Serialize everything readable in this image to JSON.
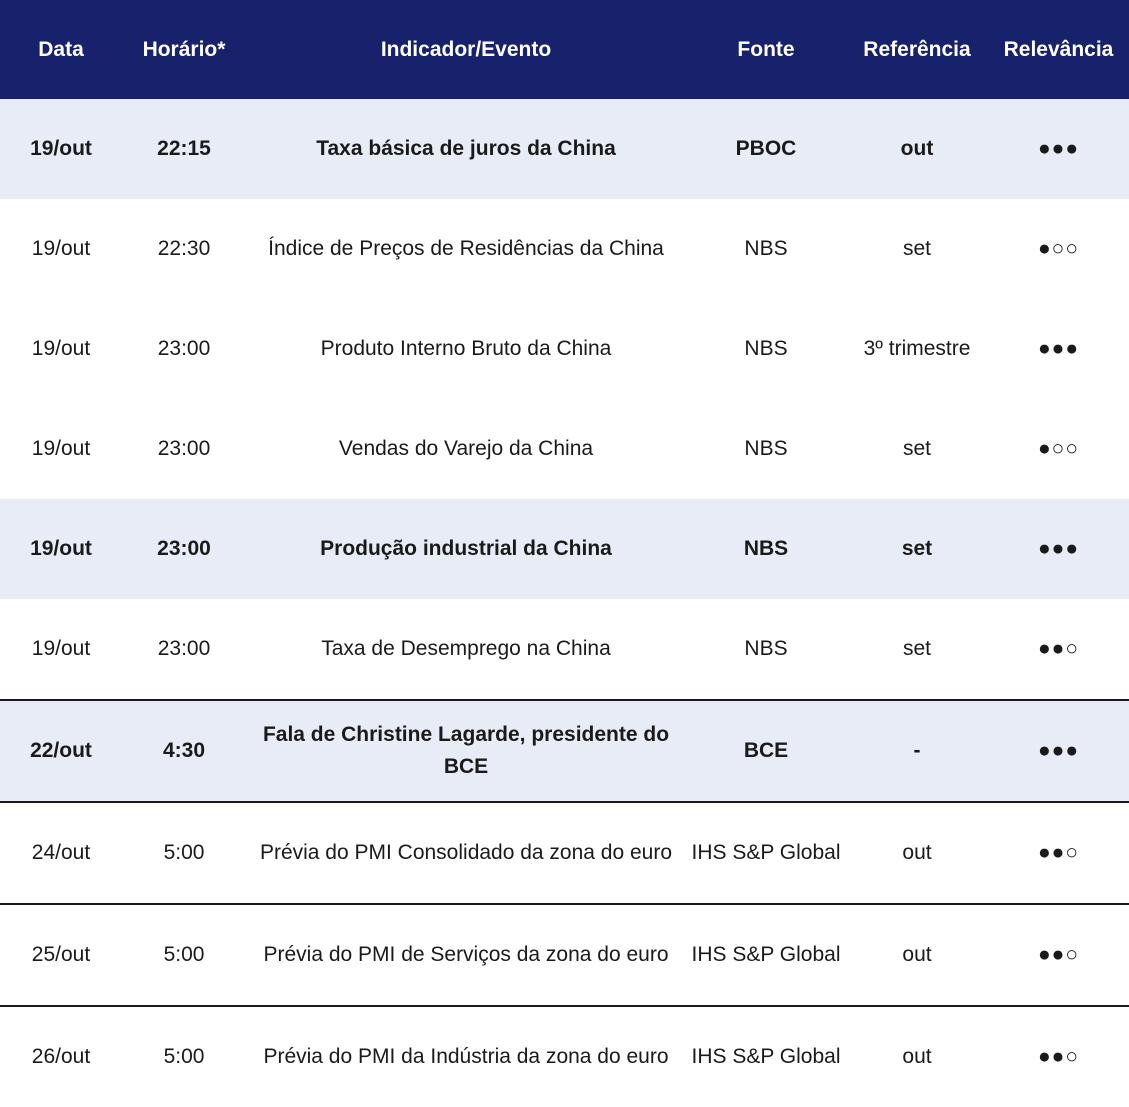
{
  "headers": {
    "date": "Data",
    "time": "Horário*",
    "event": "Indicador/Evento",
    "source": "Fonte",
    "reference": "Referência",
    "relevance": "Relevância"
  },
  "rows": [
    {
      "date": "19/out",
      "time": "22:15",
      "event": "Taxa básica de juros da China",
      "source": "PBOC",
      "reference": "out",
      "relevance": "●●●",
      "highlight": true
    },
    {
      "date": "19/out",
      "time": "22:30",
      "event": "Índice de Preços de Residências da China",
      "source": "NBS",
      "reference": "set",
      "relevance": "●○○",
      "highlight": false
    },
    {
      "date": "19/out",
      "time": "23:00",
      "event": "Produto Interno Bruto da China",
      "source": "NBS",
      "reference": "3º trimestre",
      "relevance": "●●●",
      "highlight": false
    },
    {
      "date": "19/out",
      "time": "23:00",
      "event": "Vendas do Varejo da China",
      "source": "NBS",
      "reference": "set",
      "relevance": "●○○",
      "highlight": false
    },
    {
      "date": "19/out",
      "time": "23:00",
      "event": "Produção industrial da China",
      "source": "NBS",
      "reference": "set",
      "relevance": "●●●",
      "highlight": true
    },
    {
      "date": "19/out",
      "time": "23:00",
      "event": "Taxa de Desemprego na China",
      "source": "NBS",
      "reference": "set",
      "relevance": "●●○",
      "highlight": false
    },
    {
      "date": "22/out",
      "time": "4:30",
      "event": "Fala de Christine Lagarde, presidente do BCE",
      "source": "BCE",
      "reference": "-",
      "relevance": "●●●",
      "highlight": true
    },
    {
      "date": "24/out",
      "time": "5:00",
      "event": "Prévia do PMI Consolidado da zona do euro",
      "source": "IHS S&P Global",
      "reference": "out",
      "relevance": "●●○",
      "highlight": false
    },
    {
      "date": "25/out",
      "time": "5:00",
      "event": "Prévia do PMI de Serviços da zona do euro",
      "source": "IHS S&P Global",
      "reference": "out",
      "relevance": "●●○",
      "highlight": false
    },
    {
      "date": "26/out",
      "time": "5:00",
      "event": "Prévia do PMI da Indústria da zona do euro",
      "source": "IHS S&P Global",
      "reference": "out",
      "relevance": "●●○",
      "highlight": false
    }
  ],
  "colors": {
    "header_bg": "#18216b",
    "header_text": "#ffffff",
    "highlight_bg": "#e8ecf7",
    "rule": "#1a1a1a"
  }
}
